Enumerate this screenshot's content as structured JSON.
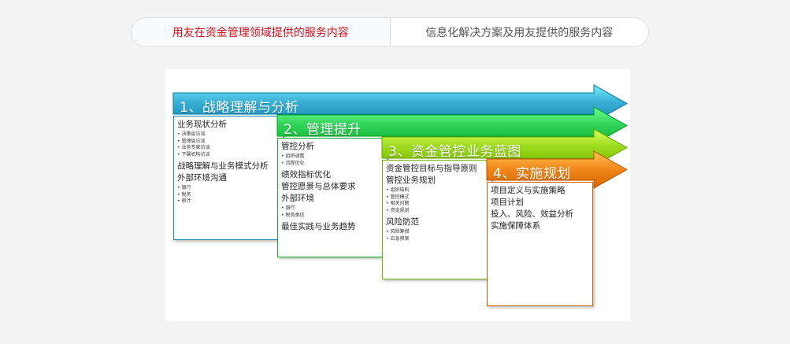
{
  "tabs": [
    {
      "label": "用友在资金管理领域提供的服务内容",
      "active": true
    },
    {
      "label": "信息化解决方案及用友提供的服务内容",
      "active": false
    }
  ],
  "stages": [
    {
      "title": "1、战略理解与分析",
      "color": "#3ab0d6",
      "content": [
        {
          "type": "heading",
          "text": "业务现状分析"
        },
        {
          "type": "bullets",
          "items": [
            "决策层访谈",
            "管理层访谈",
            "业务专家访谈",
            "下属机构访谈"
          ]
        },
        {
          "type": "heading",
          "text": "战略理解与业务模式分析"
        },
        {
          "type": "heading",
          "text": "外部环境沟通"
        },
        {
          "type": "bullets",
          "items": [
            "银行",
            "税务",
            "审计"
          ]
        }
      ]
    },
    {
      "title": "2、管理提升",
      "color": "#33d45a",
      "content": [
        {
          "type": "heading",
          "text": "管控分析"
        },
        {
          "type": "bullets",
          "items": [
            "组织调整",
            "流程优化"
          ]
        },
        {
          "type": "heading",
          "text": "绩效指标优化"
        },
        {
          "type": "heading",
          "text": "管控愿景与总体要求"
        },
        {
          "type": "heading",
          "text": "外部环境"
        },
        {
          "type": "bullets",
          "items": [
            "银行",
            "税务类信"
          ]
        },
        {
          "type": "heading",
          "text": "最佳实践与业务趋势"
        }
      ]
    },
    {
      "title": "3、资金管控业务蓝图",
      "color": "#9ddc1f",
      "content": [
        {
          "type": "heading",
          "text": "资金管控目标与指导原则"
        },
        {
          "type": "heading",
          "text": "管控业务规划"
        },
        {
          "type": "bullets",
          "items": [
            "组织结构",
            "管控模式",
            "相关问题",
            "资金规划"
          ]
        },
        {
          "type": "heading",
          "text": "风险防范"
        },
        {
          "type": "bullets",
          "items": [
            "风险筹措",
            "应急预案"
          ]
        }
      ]
    },
    {
      "title": "4、实施规划",
      "color": "#f48a1c",
      "content": [
        {
          "type": "heading",
          "text": "项目定义与实施策略"
        },
        {
          "type": "heading",
          "text": "项目计划"
        },
        {
          "type": "heading",
          "text": "投入、风险、效益分析"
        },
        {
          "type": "heading",
          "text": "实施保障体系"
        }
      ]
    }
  ]
}
